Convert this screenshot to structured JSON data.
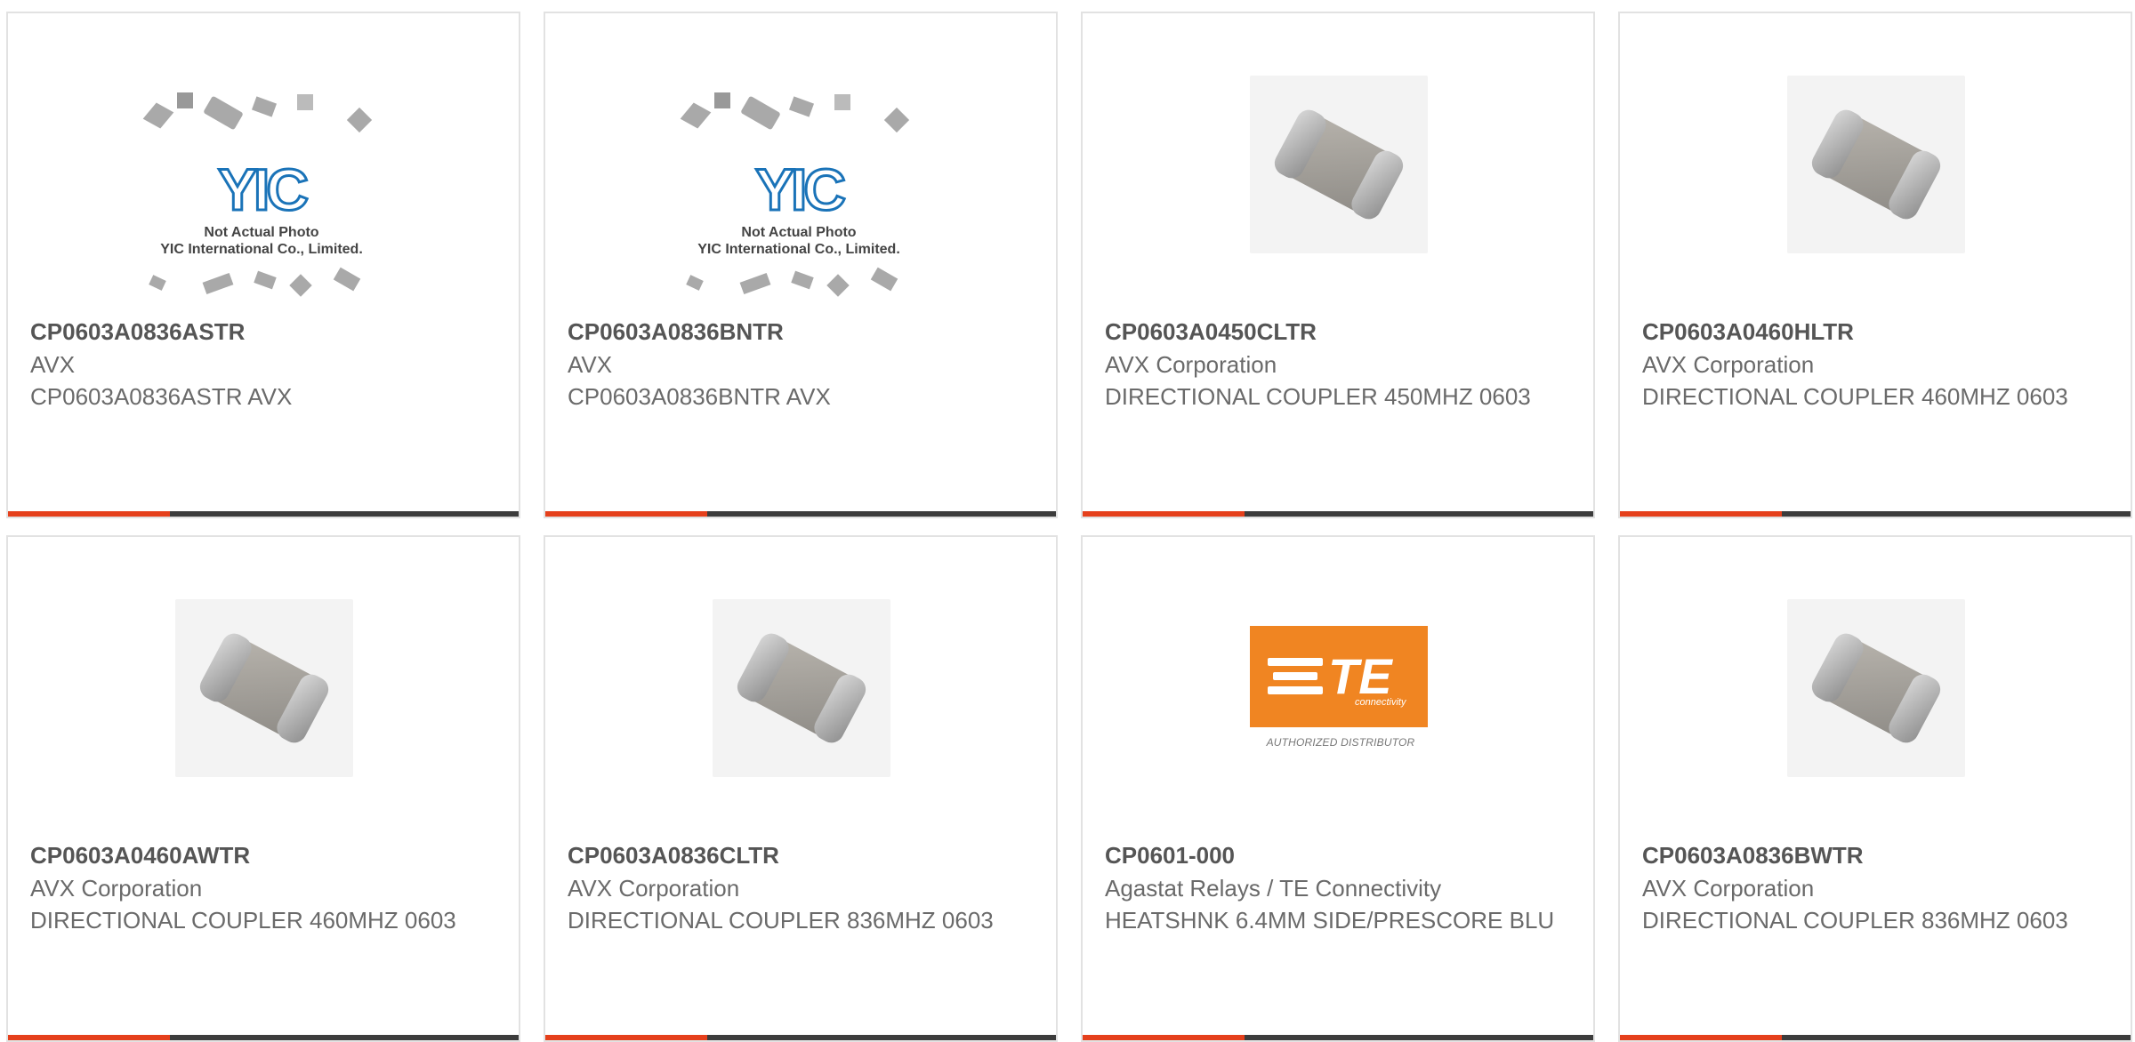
{
  "products": [
    {
      "part_number": "CP0603A0836ASTR",
      "manufacturer": "AVX",
      "description": "CP0603A0836ASTR AVX",
      "image": "yic-placeholder"
    },
    {
      "part_number": "CP0603A0836BNTR",
      "manufacturer": "AVX",
      "description": "CP0603A0836BNTR AVX",
      "image": "yic-placeholder"
    },
    {
      "part_number": "CP0603A0450CLTR",
      "manufacturer": "AVX Corporation",
      "description": "DIRECTIONAL COUPLER 450MHZ 0603",
      "image": "smd-chip"
    },
    {
      "part_number": "CP0603A0460HLTR",
      "manufacturer": "AVX Corporation",
      "description": "DIRECTIONAL COUPLER 460MHZ 0603",
      "image": "smd-chip"
    },
    {
      "part_number": "CP0603A0460AWTR",
      "manufacturer": "AVX Corporation",
      "description": "DIRECTIONAL COUPLER 460MHZ 0603",
      "image": "smd-chip"
    },
    {
      "part_number": "CP0603A0836CLTR",
      "manufacturer": "AVX Corporation",
      "description": "DIRECTIONAL COUPLER 836MHZ 0603",
      "image": "smd-chip"
    },
    {
      "part_number": "CP0601-000",
      "manufacturer": "Agastat Relays / TE Connectivity",
      "description": "HEATSHNK 6.4MM SIDE/PRESCORE BLU",
      "image": "te-logo"
    },
    {
      "part_number": "CP0603A0836BWTR",
      "manufacturer": "AVX Corporation",
      "description": "DIRECTIONAL COUPLER 836MHZ 0603",
      "image": "smd-chip"
    }
  ],
  "yic_image": {
    "logo_text": "YIC",
    "caption_line1": "Not Actual Photo",
    "caption_line2": "YIC International Co., Limited."
  },
  "te_image": {
    "logo_text": "TE",
    "sub_text": "connectivity",
    "caption": "AUTHORIZED DISTRIBUTOR"
  },
  "colors": {
    "accent": "#e5401c",
    "bar": "#3c3c3c",
    "border": "#e2e2e2",
    "te_orange": "#f08522",
    "yic_blue": "#1a73b8"
  }
}
